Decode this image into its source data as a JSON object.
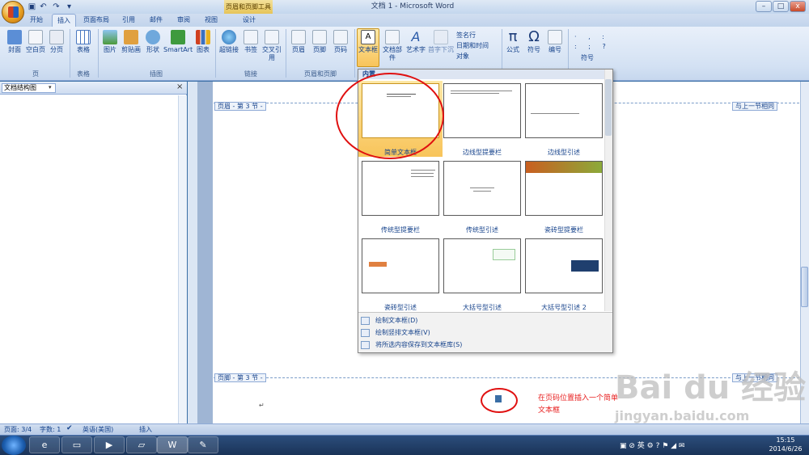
{
  "title": {
    "app": "文档 1 - Microsoft Word",
    "context_tool": "页眉和页脚工具"
  },
  "window_buttons": {
    "min": "–",
    "max": "□",
    "close": "x"
  },
  "tabs": [
    "开始",
    "插入",
    "页面布局",
    "引用",
    "邮件",
    "审阅",
    "视图",
    "设计"
  ],
  "ribbon": {
    "groups": [
      "页",
      "表格",
      "插图",
      "链接",
      "页眉和页脚",
      "符号"
    ],
    "buttons": [
      "封面",
      "空白页",
      "分页",
      "表格",
      "图片",
      "剪贴画",
      "形状",
      "SmartArt",
      "图表",
      "超链接",
      "书签",
      "交叉引用",
      "页眉",
      "页脚",
      "页码",
      "文本框",
      "文档部件",
      "艺术字",
      "首字下沉",
      "公式",
      "符号",
      "编号"
    ],
    "small": [
      "签名行",
      "日期和时间",
      "对象"
    ],
    "symbols": {
      "pi": "π",
      "omega": "Ω",
      "sym_label": "符号"
    }
  },
  "nav": {
    "title": "文档结构图",
    "close": "×"
  },
  "doc": {
    "header_tag": "页眉 - 第 3 节 -",
    "footer_tag": "页脚 - 第 3 节 -",
    "same_as_prev": "与上一节相同"
  },
  "gallery": {
    "header": "内置",
    "items": [
      "简单文本框",
      "边线型提要栏",
      "边线型引述",
      "传统型提要栏",
      "传统型引述",
      "瓷砖型提要栏",
      "瓷砖型引述",
      "大括号型引述",
      "大括号型引述 2"
    ],
    "menu": [
      "绘制文本框(D)",
      "绘制竖排文本框(V)",
      "将所选内容保存到文本框库(S)"
    ]
  },
  "status": {
    "page": "页面: 3/4",
    "words": "字数: 1",
    "lang": "英语(美国)",
    "mode": "插入"
  },
  "annotation": "在页码位置插入一个简单文本框",
  "clock": {
    "time": "15:15",
    "date": "2014/6/26"
  },
  "taskbar": {
    "tray_lang": "英"
  },
  "watermark": {
    "brand": "Bai du 经验",
    "url": "jingyan.baidu.com"
  }
}
